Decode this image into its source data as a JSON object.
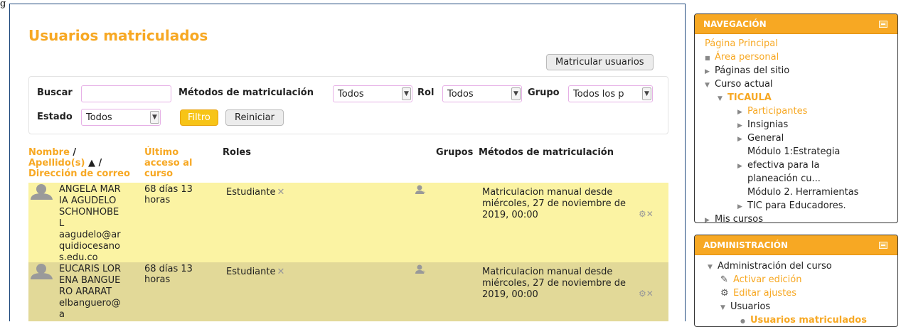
{
  "stray_char": "g",
  "page_title": "Usuarios matriculados",
  "enrol_button": "Matricular usuarios",
  "filters": {
    "search_label": "Buscar",
    "search_value": "",
    "methods_label": "Métodos de matriculación",
    "methods_value": "Todos",
    "role_label": "Rol",
    "role_value": "Todos",
    "group_label": "Grupo",
    "group_value": "Todos los p",
    "status_label": "Estado",
    "status_value": "Todos",
    "filter_button": "Filtro",
    "reset_button": "Reiniciar"
  },
  "table": {
    "col_name": "Nombre",
    "col_name_sep": "/",
    "col_surname": "Apellido(s)",
    "col_surname_sort": "▲ /",
    "col_email": "Dirección de correo",
    "col_access_1": "Último",
    "col_access_2": "acceso al",
    "col_access_3": "curso",
    "col_roles": "Roles",
    "col_groups": "Grupos",
    "col_methods": "Métodos de matriculación",
    "rows": [
      {
        "name": "ANGELA MARIA AGUDELO SCHONHOBEL",
        "email": "aagudelo@arquidiocesanos.edu.co",
        "access": "68 días 13 horas",
        "role": "Estudiante",
        "method": "Matriculacion manual desde miércoles, 27 de noviembre de 2019, 00:00"
      },
      {
        "name": "EUCARIS LORENA BANGUERO ARARAT",
        "email": "elbanguero@a",
        "access": "68 días 13 horas",
        "role": "Estudiante",
        "method": "Matriculacion manual desde miércoles, 27 de noviembre de 2019, 00:00"
      }
    ]
  },
  "nav_block": {
    "title": "NAVEGACIÓN",
    "home": "Página Principal",
    "personal": "Área personal",
    "site_pages": "Páginas del sitio",
    "current_course": "Curso actual",
    "course": "TICAULA",
    "participants": "Participantes",
    "badges": "Insignias",
    "general": "General",
    "module1_a": "Módulo 1:Estrategia",
    "module1_b": "efectiva para la",
    "module1_c": "planeación cu...",
    "module2_a": "Módulo 2. Herramientas",
    "module2_b": "TIC para Educadores.",
    "my_courses": "Mis cursos"
  },
  "admin_block": {
    "title": "ADMINISTRACIÓN",
    "course_admin": "Administración del curso",
    "edit_on": "Activar edición",
    "edit_settings": "Editar ajustes",
    "users": "Usuarios",
    "enrolled_users": "Usuarios matriculados"
  },
  "colors": {
    "accent": "#f7a823",
    "row_odd": "#fbf3a3",
    "row_even": "#e2d998"
  }
}
